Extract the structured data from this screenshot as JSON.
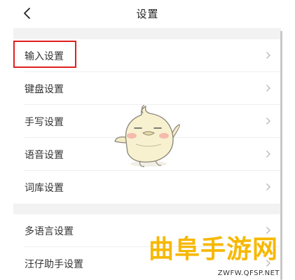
{
  "header": {
    "title": "设置",
    "back_icon": "chevron-left-icon"
  },
  "groups": [
    {
      "items": [
        {
          "label": "输入设置",
          "icon": "chevron-right-icon"
        },
        {
          "label": "键盘设置",
          "icon": "chevron-right-icon"
        },
        {
          "label": "手写设置",
          "icon": "chevron-right-icon"
        },
        {
          "label": "语音设置",
          "icon": "chevron-right-icon"
        },
        {
          "label": "词库设置",
          "icon": "chevron-right-icon"
        }
      ]
    },
    {
      "items": [
        {
          "label": "多语言设置",
          "icon": "chevron-right-icon"
        },
        {
          "label": "汪仔助手设置",
          "icon": "chevron-right-icon"
        }
      ]
    }
  ],
  "highlight": {
    "target": "输入设置",
    "color": "#e02020"
  },
  "watermark": {
    "main": "曲阜手游网",
    "sub": "ZWFW.QFSP.NET",
    "color": "#f6b800"
  },
  "colors": {
    "background": "#ffffff",
    "section_gap": "#f2f2f2",
    "text": "#333333",
    "chevron": "#b5b5b5"
  }
}
